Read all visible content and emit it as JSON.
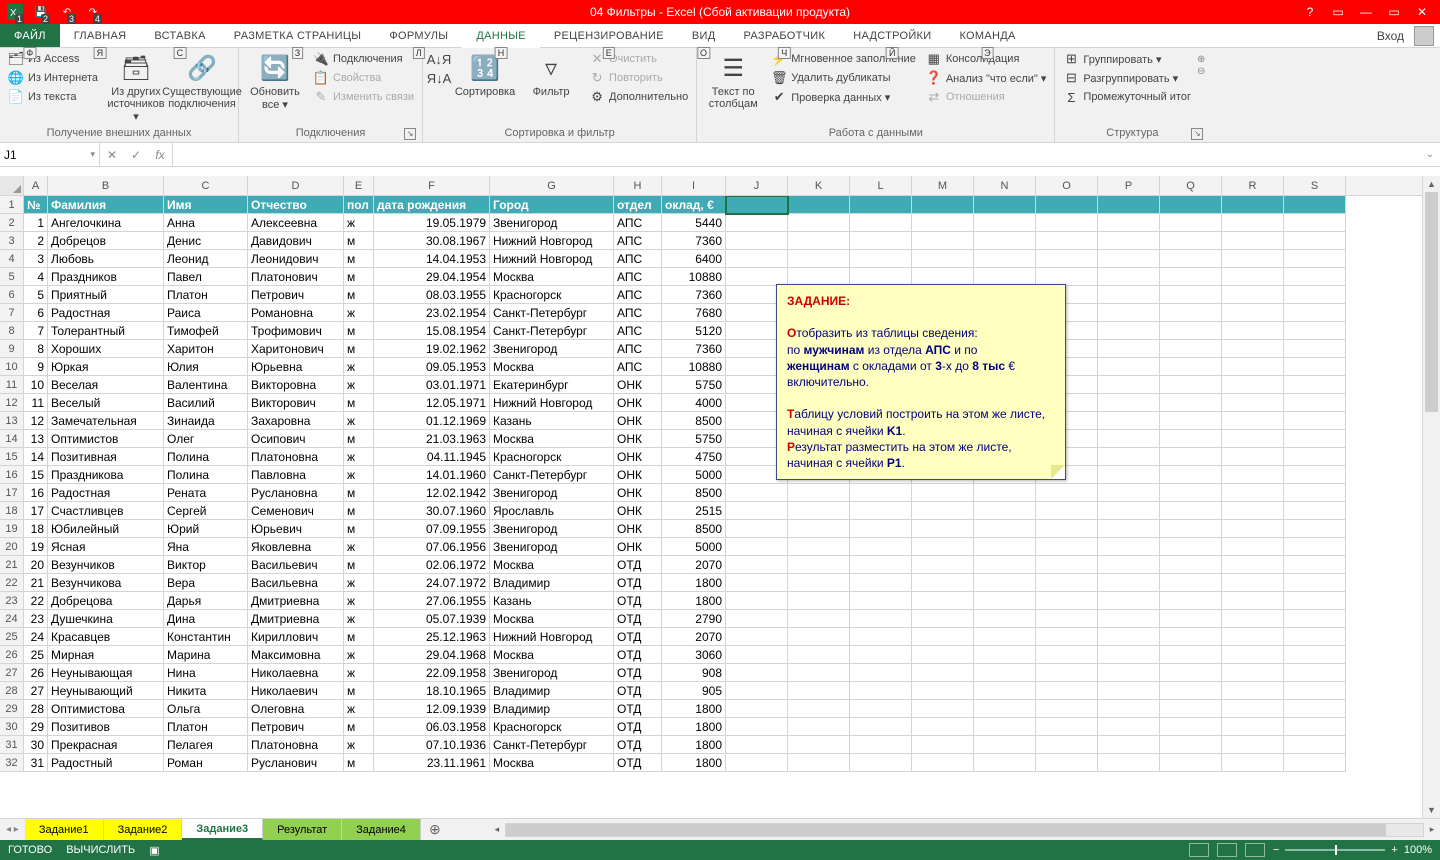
{
  "title": "04 Фильтры -  Excel (Сбой активации продукта)",
  "qat_badges": [
    "1",
    "2",
    "3",
    "4"
  ],
  "win": {
    "help": "?",
    "opts": "▭",
    "min": "—",
    "max": "▭",
    "close": "✕"
  },
  "login": "Вход",
  "tabs": {
    "file": "ФАЙЛ",
    "list": [
      "ГЛАВНАЯ",
      "ВСТАВКА",
      "РАЗМЕТКА СТРАНИЦЫ",
      "ФОРМУЛЫ",
      "ДАННЫЕ",
      "РЕЦЕНЗИРОВАНИЕ",
      "ВИД",
      "РАЗРАБОТЧИК",
      "НАДСТРОЙКИ",
      "Команда"
    ],
    "keytips": [
      "Ф",
      "Я",
      "С",
      "З",
      "Л",
      "Н",
      "Е",
      "О",
      "Ч",
      "Й",
      "Э"
    ],
    "active": 4
  },
  "ribbon": {
    "g1": {
      "label": "Получение внешних данных",
      "access": "Из Access",
      "web": "Из Интернета",
      "text": "Из текста",
      "other": "Из других источников ▾",
      "conn": "Существующие подключения"
    },
    "g2": {
      "label": "Подключения",
      "refresh": "Обновить все ▾",
      "a": "Подключения",
      "b": "Свойства",
      "c": "Изменить связи"
    },
    "g3": {
      "label": "Сортировка и фильтр",
      "az": "А↓Я",
      "za": "Я↓А",
      "sort": "Сортировка",
      "filter": "Фильтр",
      "clear": "Очистить",
      "reapply": "Повторить",
      "adv": "Дополнительно"
    },
    "g4": {
      "label": "Работа с данными",
      "ttc": "Текст по столбцам",
      "flash": "Мгновенное заполнение",
      "dup": "Удалить дубликаты",
      "val": "Проверка данных ▾",
      "cons": "Консолидация",
      "whatif": "Анализ \"что если\" ▾",
      "rel": "Отношения"
    },
    "g5": {
      "label": "Структура",
      "grp": "Группировать ▾",
      "ungrp": "Разгруппировать ▾",
      "sub": "Промежуточный итог"
    }
  },
  "namebox": "J1",
  "fx": "fx",
  "colLetters": [
    "A",
    "B",
    "C",
    "D",
    "E",
    "F",
    "G",
    "H",
    "I",
    "J",
    "K",
    "L",
    "M",
    "N",
    "O",
    "P",
    "Q",
    "R",
    "S"
  ],
  "headers": [
    "№",
    "Фамилия",
    "Имя",
    "Отчество",
    "пол",
    "дата рождения",
    "Город",
    "отдел",
    "оклад, €"
  ],
  "rows": [
    [
      1,
      "Ангелочкина",
      "Анна",
      "Алексеевна",
      "ж",
      "19.05.1979",
      "Звенигород",
      "АПС",
      5440
    ],
    [
      2,
      "Добрецов",
      "Денис",
      "Давидович",
      "м",
      "30.08.1967",
      "Нижний Новгород",
      "АПС",
      7360
    ],
    [
      3,
      "Любовь",
      "Леонид",
      "Леонидович",
      "м",
      "14.04.1953",
      "Нижний Новгород",
      "АПС",
      6400
    ],
    [
      4,
      "Праздников",
      "Павел",
      "Платонович",
      "м",
      "29.04.1954",
      "Москва",
      "АПС",
      10880
    ],
    [
      5,
      "Приятный",
      "Платон",
      "Петрович",
      "м",
      "08.03.1955",
      "Красногорск",
      "АПС",
      7360
    ],
    [
      6,
      "Радостная",
      "Раиса",
      "Романовна",
      "ж",
      "23.02.1954",
      "Санкт-Петербург",
      "АПС",
      7680
    ],
    [
      7,
      "Толерантный",
      "Тимофей",
      "Трофимович",
      "м",
      "15.08.1954",
      "Санкт-Петербург",
      "АПС",
      5120
    ],
    [
      8,
      "Хороших",
      "Харитон",
      "Харитонович",
      "м",
      "19.02.1962",
      "Звенигород",
      "АПС",
      7360
    ],
    [
      9,
      "Юркая",
      "Юлия",
      "Юрьевна",
      "ж",
      "09.05.1953",
      "Москва",
      "АПС",
      10880
    ],
    [
      10,
      "Веселая",
      "Валентина",
      "Викторовна",
      "ж",
      "03.01.1971",
      "Екатеринбург",
      "ОНК",
      5750
    ],
    [
      11,
      "Веселый",
      "Василий",
      "Викторович",
      "м",
      "12.05.1971",
      "Нижний Новгород",
      "ОНК",
      4000
    ],
    [
      12,
      "Замечательная",
      "Зинаида",
      "Захаровна",
      "ж",
      "01.12.1969",
      "Казань",
      "ОНК",
      8500
    ],
    [
      13,
      "Оптимистов",
      "Олег",
      "Осипович",
      "м",
      "21.03.1963",
      "Москва",
      "ОНК",
      5750
    ],
    [
      14,
      "Позитивная",
      "Полина",
      "Платоновна",
      "ж",
      "04.11.1945",
      "Красногорск",
      "ОНК",
      4750
    ],
    [
      15,
      "Праздникова",
      "Полина",
      "Павловна",
      "ж",
      "14.01.1960",
      "Санкт-Петербург",
      "ОНК",
      5000
    ],
    [
      16,
      "Радостная",
      "Рената",
      "Руслановна",
      "м",
      "12.02.1942",
      "Звенигород",
      "ОНК",
      8500
    ],
    [
      17,
      "Счастливцев",
      "Сергей",
      "Семенович",
      "м",
      "30.07.1960",
      "Ярославль",
      "ОНК",
      2515
    ],
    [
      18,
      "Юбилейный",
      "Юрий",
      "Юрьевич",
      "м",
      "07.09.1955",
      "Звенигород",
      "ОНК",
      8500
    ],
    [
      19,
      "Ясная",
      "Яна",
      "Яковлевна",
      "ж",
      "07.06.1956",
      "Звенигород",
      "ОНК",
      5000
    ],
    [
      20,
      "Везунчиков",
      "Виктор",
      "Васильевич",
      "м",
      "02.06.1972",
      "Москва",
      "ОТД",
      2070
    ],
    [
      21,
      "Везунчикова",
      "Вера",
      "Васильевна",
      "ж",
      "24.07.1972",
      "Владимир",
      "ОТД",
      1800
    ],
    [
      22,
      "Добрецова",
      "Дарья",
      "Дмитриевна",
      "ж",
      "27.06.1955",
      "Казань",
      "ОТД",
      1800
    ],
    [
      23,
      "Душечкина",
      "Дина",
      "Дмитриевна",
      "ж",
      "05.07.1939",
      "Москва",
      "ОТД",
      2790
    ],
    [
      24,
      "Красавцев",
      "Константин",
      "Кириллович",
      "м",
      "25.12.1963",
      "Нижний Новгород",
      "ОТД",
      2070
    ],
    [
      25,
      "Мирная",
      "Марина",
      "Максимовна",
      "ж",
      "29.04.1968",
      "Москва",
      "ОТД",
      3060
    ],
    [
      26,
      "Неунывающая",
      "Нина",
      "Николаевна",
      "ж",
      "22.09.1958",
      "Звенигород",
      "ОТД",
      908
    ],
    [
      27,
      "Неунывающий",
      "Никита",
      "Николаевич",
      "м",
      "18.10.1965",
      "Владимир",
      "ОТД",
      905
    ],
    [
      28,
      "Оптимистова",
      "Ольга",
      "Олеговна",
      "ж",
      "12.09.1939",
      "Владимир",
      "ОТД",
      1800
    ],
    [
      29,
      "Позитивов",
      "Платон",
      "Петрович",
      "м",
      "06.03.1958",
      "Красногорск",
      "ОТД",
      1800
    ],
    [
      30,
      "Прекрасная",
      "Пелагея",
      "Платоновна",
      "ж",
      "07.10.1936",
      "Санкт-Петербург",
      "ОТД",
      1800
    ],
    [
      31,
      "Радостный",
      "Роман",
      "Русланович",
      "м",
      "23.11.1961",
      "Москва",
      "ОТД",
      1800
    ]
  ],
  "comment": {
    "title": "ЗАДАНИЕ:",
    "p1a": "О",
    "p1b": "тобразить из таблицы сведения:",
    "p2": "по ",
    "p2b": "мужчинам",
    "p2c": " из отдела ",
    "p2d": "АПС",
    "p2e": " и по",
    "p3a": "женщинам",
    "p3b": " с окладами от ",
    "p3c": "3",
    "p3d": "-х до ",
    "p3e": "8 тыс",
    "p3f": " € включительно.",
    "p4a": "Т",
    "p4b": "аблицу условий построить на этом же листе, начиная с ячейки ",
    "p4c": "K1",
    "p4d": ".",
    "p5a": "Р",
    "p5b": "езультат разместить на этом же листе, начиная с ячейки ",
    "p5c": "P1",
    "p5d": "."
  },
  "sheets": [
    {
      "name": "Задание1",
      "cls": "y"
    },
    {
      "name": "Задание2",
      "cls": "y"
    },
    {
      "name": "Задание3",
      "cls": "active"
    },
    {
      "name": "Результат",
      "cls": "g"
    },
    {
      "name": "Задание4",
      "cls": "g"
    }
  ],
  "status": {
    "ready": "ГОТОВО",
    "calc": "ВЫЧИСЛИТЬ",
    "zoom": "100%"
  }
}
